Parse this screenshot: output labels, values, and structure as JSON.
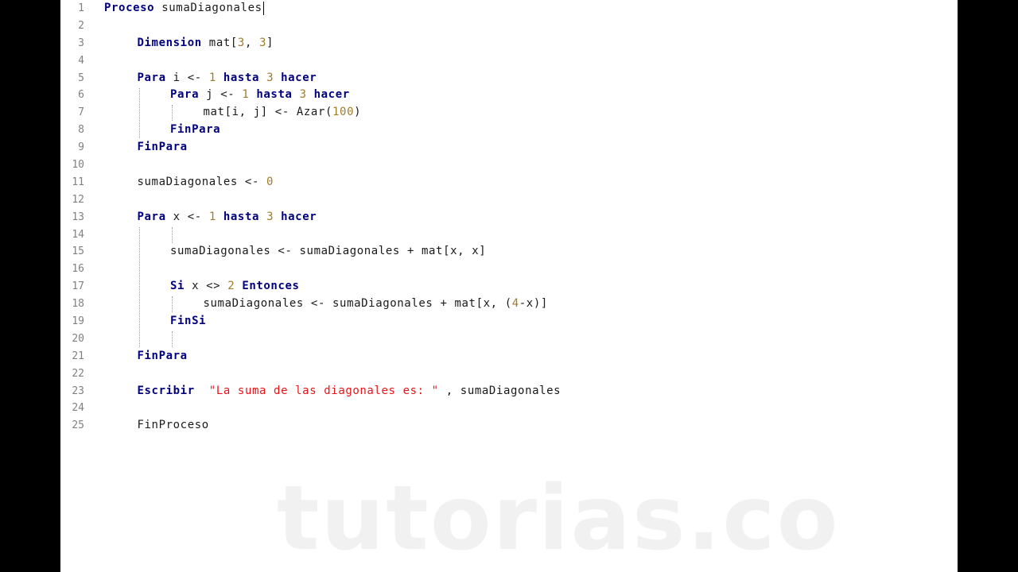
{
  "editor": {
    "watermark": "tutorias.co",
    "caret_after_line": 1,
    "lines": [
      {
        "n": "1",
        "indent": 0,
        "tokens": [
          {
            "t": "Proceso",
            "c": "kw"
          },
          {
            "t": " sumaDiagonales",
            "c": "id"
          }
        ]
      },
      {
        "n": "2",
        "indent": 0,
        "tokens": []
      },
      {
        "n": "3",
        "indent": 1,
        "tokens": [
          {
            "t": "Dimension",
            "c": "kw"
          },
          {
            "t": " mat[",
            "c": "id"
          },
          {
            "t": "3",
            "c": "num"
          },
          {
            "t": ", ",
            "c": "id"
          },
          {
            "t": "3",
            "c": "num"
          },
          {
            "t": "]",
            "c": "id"
          }
        ]
      },
      {
        "n": "4",
        "indent": 0,
        "tokens": []
      },
      {
        "n": "5",
        "indent": 1,
        "tokens": [
          {
            "t": "Para",
            "c": "kw"
          },
          {
            "t": " i <- ",
            "c": "id"
          },
          {
            "t": "1",
            "c": "num"
          },
          {
            "t": " ",
            "c": "id"
          },
          {
            "t": "hasta",
            "c": "kw"
          },
          {
            "t": " ",
            "c": "id"
          },
          {
            "t": "3",
            "c": "num"
          },
          {
            "t": " ",
            "c": "id"
          },
          {
            "t": "hacer",
            "c": "kw"
          }
        ]
      },
      {
        "n": "6",
        "indent": 2,
        "tokens": [
          {
            "t": "Para",
            "c": "kw"
          },
          {
            "t": " j <- ",
            "c": "id"
          },
          {
            "t": "1",
            "c": "num"
          },
          {
            "t": " ",
            "c": "id"
          },
          {
            "t": "hasta",
            "c": "kw"
          },
          {
            "t": " ",
            "c": "id"
          },
          {
            "t": "3",
            "c": "num"
          },
          {
            "t": " ",
            "c": "id"
          },
          {
            "t": "hacer",
            "c": "kw"
          }
        ]
      },
      {
        "n": "7",
        "indent": 3,
        "tokens": [
          {
            "t": "mat[i, j] <- ",
            "c": "id"
          },
          {
            "t": "Azar",
            "c": "fn"
          },
          {
            "t": "(",
            "c": "id"
          },
          {
            "t": "100",
            "c": "num"
          },
          {
            "t": ")",
            "c": "id"
          }
        ]
      },
      {
        "n": "8",
        "indent": 2,
        "tokens": [
          {
            "t": "FinPara",
            "c": "kw"
          }
        ]
      },
      {
        "n": "9",
        "indent": 1,
        "tokens": [
          {
            "t": "FinPara",
            "c": "kw"
          }
        ]
      },
      {
        "n": "10",
        "indent": 0,
        "tokens": []
      },
      {
        "n": "11",
        "indent": 1,
        "tokens": [
          {
            "t": "sumaDiagonales <- ",
            "c": "id"
          },
          {
            "t": "0",
            "c": "num"
          }
        ]
      },
      {
        "n": "12",
        "indent": 0,
        "tokens": []
      },
      {
        "n": "13",
        "indent": 1,
        "tokens": [
          {
            "t": "Para",
            "c": "kw"
          },
          {
            "t": " x <- ",
            "c": "id"
          },
          {
            "t": "1",
            "c": "num"
          },
          {
            "t": " ",
            "c": "id"
          },
          {
            "t": "hasta",
            "c": "kw"
          },
          {
            "t": " ",
            "c": "id"
          },
          {
            "t": "3",
            "c": "num"
          },
          {
            "t": " ",
            "c": "id"
          },
          {
            "t": "hacer",
            "c": "kw"
          }
        ]
      },
      {
        "n": "14",
        "indent": 0,
        "tokens": []
      },
      {
        "n": "15",
        "indent": 2,
        "tokens": [
          {
            "t": "sumaDiagonales <- sumaDiagonales + mat[x, x]",
            "c": "id"
          }
        ]
      },
      {
        "n": "16",
        "indent": 0,
        "tokens": []
      },
      {
        "n": "17",
        "indent": 2,
        "tokens": [
          {
            "t": "Si",
            "c": "kw"
          },
          {
            "t": " x <> ",
            "c": "id"
          },
          {
            "t": "2",
            "c": "num"
          },
          {
            "t": " ",
            "c": "id"
          },
          {
            "t": "Entonces",
            "c": "kw"
          }
        ]
      },
      {
        "n": "18",
        "indent": 3,
        "tokens": [
          {
            "t": "sumaDiagonales <- sumaDiagonales + mat[x, (",
            "c": "id"
          },
          {
            "t": "4",
            "c": "num"
          },
          {
            "t": "-x)]",
            "c": "id"
          }
        ]
      },
      {
        "n": "19",
        "indent": 2,
        "tokens": [
          {
            "t": "FinSi",
            "c": "kw"
          }
        ]
      },
      {
        "n": "20",
        "indent": 0,
        "tokens": []
      },
      {
        "n": "21",
        "indent": 1,
        "tokens": [
          {
            "t": "FinPara",
            "c": "kw"
          }
        ]
      },
      {
        "n": "22",
        "indent": 0,
        "tokens": []
      },
      {
        "n": "23",
        "indent": 1,
        "tokens": [
          {
            "t": "Escribir",
            "c": "kw"
          },
          {
            "t": "  ",
            "c": "id"
          },
          {
            "t": "\"La suma de las diagonales es: \"",
            "c": "str"
          },
          {
            "t": " , sumaDiagonales",
            "c": "id"
          }
        ]
      },
      {
        "n": "24",
        "indent": 0,
        "tokens": []
      },
      {
        "n": "25",
        "indent": 1,
        "tokens": [
          {
            "t": "FinProceso",
            "c": "id"
          }
        ]
      }
    ]
  }
}
